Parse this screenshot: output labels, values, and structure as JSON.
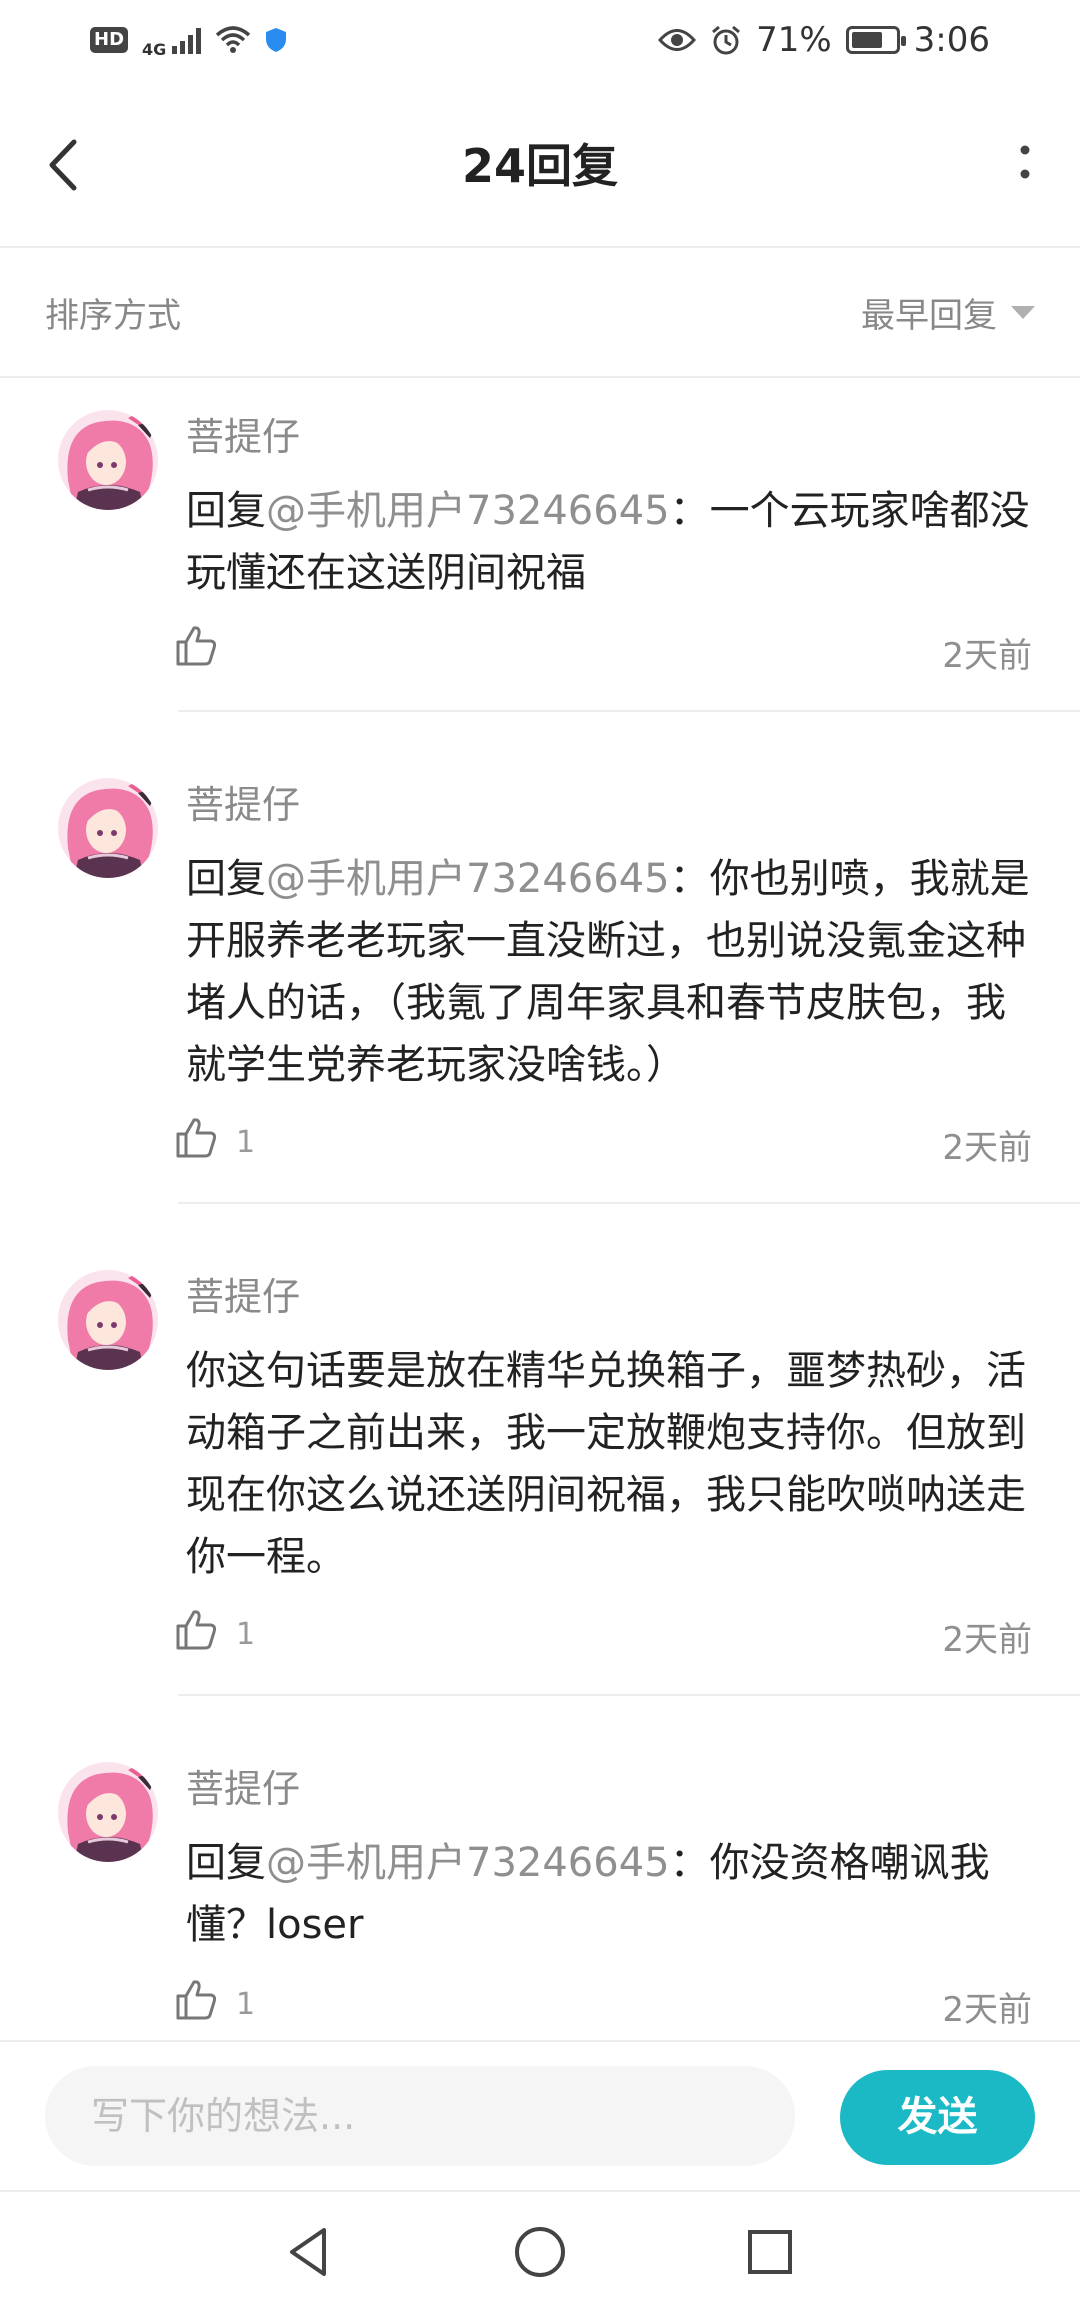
{
  "status_bar": {
    "hd": "HD",
    "network": "4G",
    "battery_percent": "71%",
    "battery_level": 0.71,
    "time": "3:06"
  },
  "header": {
    "title": "24回复"
  },
  "sort_bar": {
    "label": "排序方式",
    "selected": "最早回复"
  },
  "comments": [
    {
      "user": "菩提仔",
      "reply_prefix": "回复",
      "mention": "@手机用户73246645",
      "text": "：一个云玩家啥都没玩懂还在这送阴间祝福",
      "likes": "",
      "time": "2天前"
    },
    {
      "user": "菩提仔",
      "reply_prefix": "回复",
      "mention": "@手机用户73246645",
      "text": "：你也别喷，我就是开服养老老玩家一直没断过，也别说没氪金这种堵人的话，（我氪了周年家具和春节皮肤包，我就学生党养老玩家没啥钱。）",
      "likes": "1",
      "time": "2天前"
    },
    {
      "user": "菩提仔",
      "reply_prefix": "",
      "mention": "",
      "text": "你这句话要是放在精华兑换箱子，噩梦热砂，活动箱子之前出来，我一定放鞭炮支持你。但放到现在你这么说还送阴间祝福，我只能吹唢呐送走你一程。",
      "likes": "1",
      "time": "2天前"
    },
    {
      "user": "菩提仔",
      "reply_prefix": "回复",
      "mention": "@手机用户73246645",
      "text": "：你没资格嘲讽我懂？loser",
      "likes": "1",
      "time": "2天前"
    }
  ],
  "input_bar": {
    "placeholder": "写下你的想法...",
    "send_label": "发送"
  },
  "colors": {
    "accent": "#1bb9c6",
    "avatar_hair": "#f07aa8"
  }
}
